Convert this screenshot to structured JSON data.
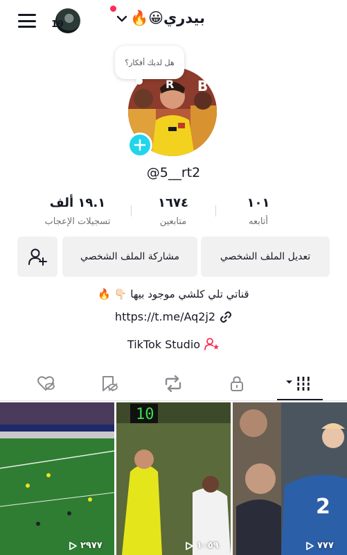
{
  "header": {
    "notification_badge": "19",
    "display_name": "بيدري😀🔥"
  },
  "bubble": {
    "text": "هل لديك أفكار؟"
  },
  "profile": {
    "handle": "@5__rt2"
  },
  "stats": {
    "following": {
      "value": "١٠١",
      "label": "أتابعه"
    },
    "followers": {
      "value": "١٦٧٤",
      "label": "متابعين"
    },
    "likes": {
      "value": "١٩.١ ألف",
      "label": "تسجيلات الإعجاب"
    }
  },
  "buttons": {
    "edit_profile": "تعديل الملف الشخصي",
    "share_profile": "مشاركة الملف الشخصي"
  },
  "bio": {
    "text": "قناتي تلي كلشي موجود بيها 👇🏻 🔥",
    "link": "https://t.me/Aq2j2"
  },
  "studio": {
    "label": "TikTok Studio"
  },
  "tabs": [
    "videos-grid",
    "lock",
    "repost",
    "favorites",
    "liked"
  ],
  "videos": [
    {
      "views": "٢٩٧٧"
    },
    {
      "views": "١٠٥٩"
    },
    {
      "views": "٧٧٧"
    }
  ],
  "colors": {
    "accent": "#fe2c55",
    "add_button": "#20d5ec",
    "button_bg": "#f1f1f2",
    "text": "#161823"
  }
}
